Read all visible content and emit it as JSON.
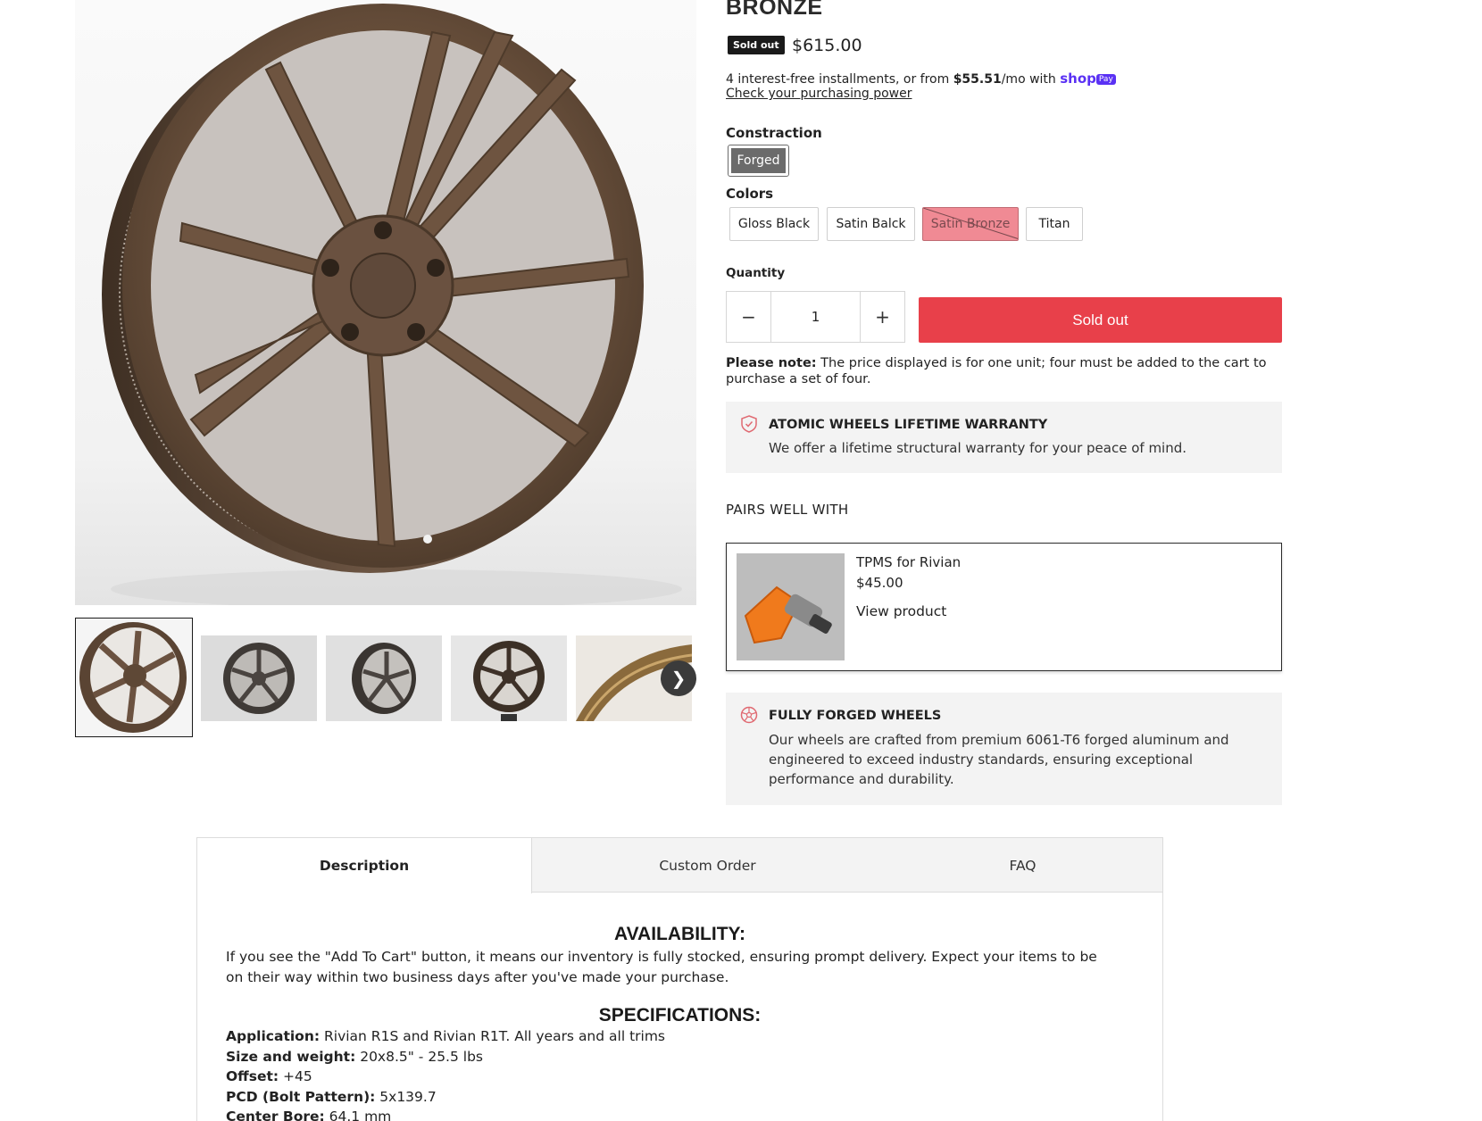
{
  "product": {
    "title_partial": "BRONZE",
    "badge": "Sold out",
    "price": "$615.00"
  },
  "installments": {
    "prefix": "4 interest-free installments, or from ",
    "amount": "$55.51",
    "suffix": "/mo with ",
    "provider": "shop",
    "provider_badge": "Pay",
    "link": "Check your purchasing power"
  },
  "construction": {
    "label": "Constraction",
    "options": [
      "Forged"
    ],
    "selected": "Forged"
  },
  "colors": {
    "label": "Colors",
    "options": [
      "Gloss Black",
      "Satin Balck",
      "Satin Bronze",
      "Titan"
    ],
    "selected": "Satin Bronze",
    "unavailable": [
      "Satin Bronze"
    ]
  },
  "quantity": {
    "label": "Quantity",
    "value": "1",
    "minus": "−",
    "plus": "+"
  },
  "cart_button": "Sold out",
  "note": {
    "bold": "Please note:",
    "text": " The price displayed is for one unit; four must be added to the cart to purchase a set of four."
  },
  "warranty": {
    "title": "ATOMIC WHEELS LIFETIME WARRANTY",
    "text": "We offer a lifetime structural warranty for your peace of mind."
  },
  "pairs": {
    "title": "PAIRS WELL WITH",
    "item": {
      "name": "TPMS for Rivian",
      "price": "$45.00",
      "link": "View product"
    }
  },
  "forged": {
    "title": "FULLY FORGED WHEELS",
    "text": "Our wheels are crafted from premium 6061-T6 forged aluminum and engineered to exceed industry standards, ensuring exceptional performance and durability."
  },
  "gallery": {
    "thumb_count": 5,
    "next_icon": "chevron-right-icon"
  },
  "tabs": [
    "Description",
    "Custom Order",
    "FAQ"
  ],
  "active_tab": "Description",
  "description": {
    "availability_heading": "AVAILABILITY:",
    "availability_text": "If you see the \"Add To Cart\" button, it means our inventory is fully stocked, ensuring prompt delivery. Expect your items to be on their way within two business days after you've made your purchase.",
    "specs_heading": "SPECIFICATIONS:",
    "specs": [
      {
        "label": "Application:",
        "value": " Rivian R1S and Rivian R1T. All years and all trims"
      },
      {
        "label": "Size and weight:",
        "value": " 20x8.5\" - 25.5 lbs"
      },
      {
        "label": "Offset:",
        "value": " +45"
      },
      {
        "label": "PCD (Bolt Pattern):",
        "value": " 5x139.7"
      },
      {
        "label": "Center Bore:",
        "value": " 64.1 mm"
      }
    ]
  },
  "colors_palette": {
    "accent_red": "#e8404a",
    "bronze": "#6e5440",
    "shop_purple": "#5a31f4"
  }
}
